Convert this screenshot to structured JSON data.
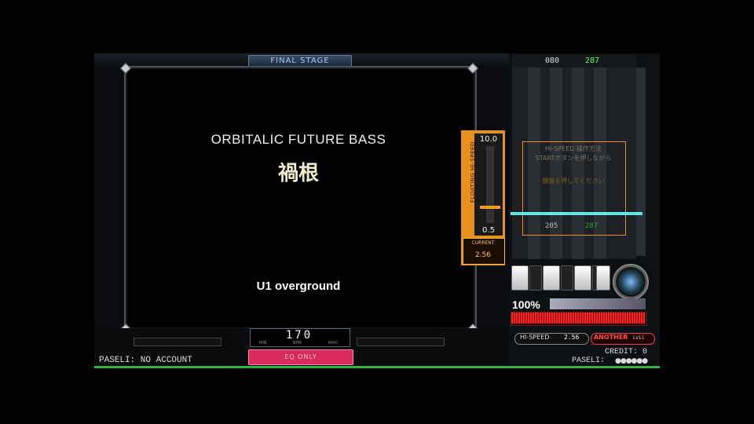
{
  "stage": {
    "label": "FINAL STAGE"
  },
  "song": {
    "genre": "ORBITALIC FUTURE BASS",
    "title": "禍根",
    "artist": "U1 overground"
  },
  "floating_hispeed": {
    "vertical_label": "FLOATING HI-SPEED",
    "max": "10.0",
    "min": "0.5",
    "value": "2.56",
    "level": 0.22,
    "sub_label": "CURRENT"
  },
  "bpm": {
    "value": "170",
    "labels": [
      "MIN",
      "BPM",
      "MAX"
    ]
  },
  "eq_button": {
    "label": "EQ ONLY"
  },
  "paseli_left": "PASELI: NO ACCOUNT",
  "lane": {
    "top_number_a": "080",
    "top_number_b": "287",
    "guide_line1": "HI-SPEED 操作方法",
    "guide_line2": "STARTボタンを押しながら",
    "guide_line3": "鍵盤を押してください",
    "green_a": "205",
    "green_b": "287"
  },
  "gauge": {
    "percent": "100%",
    "level": 1.0
  },
  "hispeed_row": {
    "label": "HI-SPEED",
    "value": "2.56"
  },
  "difficulty": {
    "label": "ANOTHER",
    "level": "Lv11"
  },
  "credit": "CREDIT: 0",
  "paseli_right": "PASELI:",
  "paseli_stars": "●●●●●●",
  "colors": {
    "accent_orange": "#e8901e",
    "eq_pink": "#d92a5a",
    "gauge_red": "#ff2222",
    "judge_cyan": "#5fe8e6",
    "status_green": "#2db53c"
  }
}
